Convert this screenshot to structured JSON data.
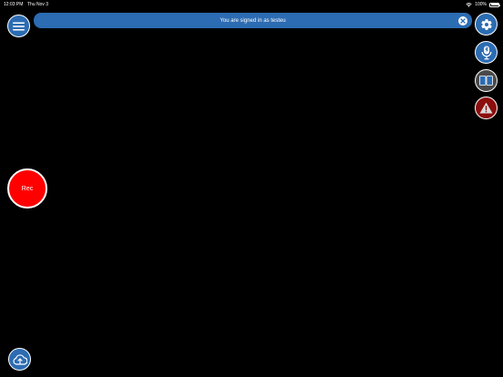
{
  "status_bar": {
    "time": "12:03 PM",
    "date": "Thu Nov 3",
    "battery": "100%"
  },
  "banner": {
    "message": "You are signed in as testeu"
  },
  "record_button": {
    "label": "Rec"
  },
  "icons": {
    "menu": "hamburger-menu-icon",
    "close": "close-icon",
    "settings": "gear-icon",
    "microphone": "bluetooth-microphone-icon",
    "display": "dual-screen-icon",
    "warning": "warning-triangle-icon",
    "upload": "cloud-upload-icon"
  },
  "colors": {
    "accent_blue": "#2c6cb3",
    "record_red": "#ff0000",
    "warning_red": "#8c0d0d",
    "background": "#000000"
  }
}
